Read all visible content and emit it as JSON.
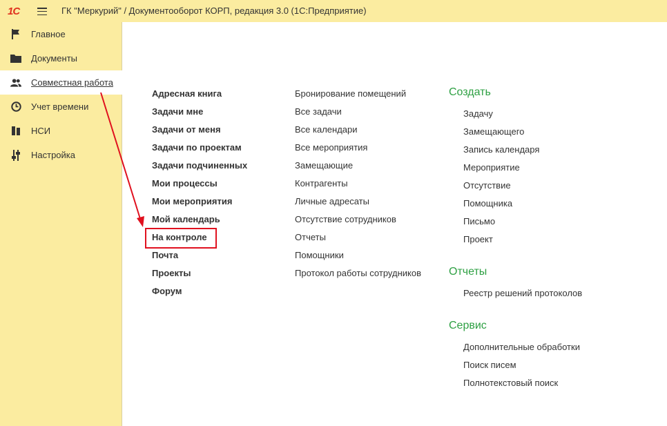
{
  "app": {
    "logo_text": "1С",
    "window_title": "ГК \"Меркурий\" / Документооборот КОРП, редакция 3.0  (1С:Предприятие)"
  },
  "sidebar": {
    "items": [
      {
        "label": "Главное",
        "icon": "flag-icon"
      },
      {
        "label": "Документы",
        "icon": "folder-icon"
      },
      {
        "label": "Совместная работа",
        "icon": "people-icon",
        "active": true
      },
      {
        "label": "Учет времени",
        "icon": "clock-icon"
      },
      {
        "label": "НСИ",
        "icon": "books-icon"
      },
      {
        "label": "Настройка",
        "icon": "sliders-icon"
      }
    ]
  },
  "main": {
    "col1": [
      "Адресная книга",
      "Задачи мне",
      "Задачи от меня",
      "Задачи по проектам",
      "Задачи подчиненных",
      "Мои процессы",
      "Мои мероприятия",
      "Мой календарь",
      "На контроле",
      "Почта",
      "Проекты",
      "Форум"
    ],
    "col2": [
      "Бронирование помещений",
      "Все задачи",
      "Все календари",
      "Все мероприятия",
      "Замещающие",
      "Контрагенты",
      "Личные адресаты",
      "Отсутствие сотрудников",
      "Отчеты",
      "Помощники",
      "Протокол работы сотрудников"
    ],
    "create": {
      "title": "Создать",
      "items": [
        "Задачу",
        "Замещающего",
        "Запись календаря",
        "Мероприятие",
        "Отсутствие",
        "Помощника",
        "Письмо",
        "Проект"
      ]
    },
    "reports": {
      "title": "Отчеты",
      "items": [
        "Реестр решений протоколов"
      ]
    },
    "service": {
      "title": "Сервис",
      "items": [
        "Дополнительные обработки",
        "Поиск писем",
        "Полнотекстовый поиск"
      ]
    }
  },
  "colors": {
    "sidebar_bg": "#fbeca0",
    "section_heading": "#2ea043",
    "annotation_red": "#e0101e",
    "logo_red": "#e0301e"
  }
}
